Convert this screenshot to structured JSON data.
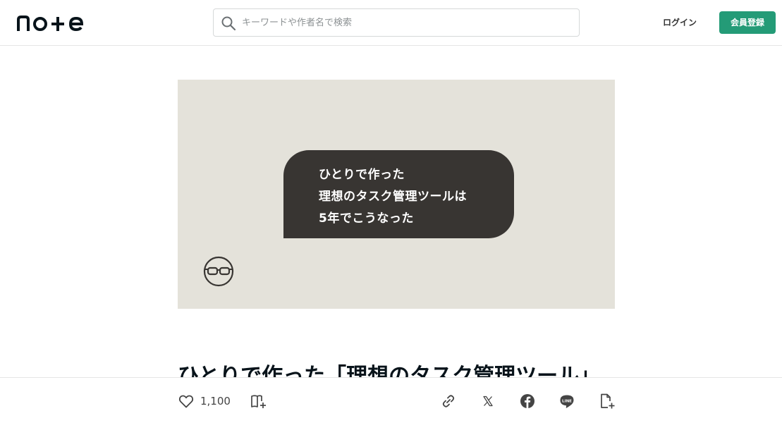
{
  "header": {
    "logo_text": "note",
    "search": {
      "placeholder": "キーワードや作者名で検索",
      "value": ""
    },
    "login_label": "ログイン",
    "signup_label": "会員登録",
    "accent_color": "#249b77"
  },
  "eyecatch": {
    "lines": [
      "ひとりで作った",
      "理想のタスク管理ツールは",
      "5年でこうなった"
    ],
    "avatar_icon": "glasses-face-icon",
    "background": "#e4e2da",
    "bubble_color": "#383532"
  },
  "article": {
    "title": "ひとりで作った「理想のタスク管理ツール」"
  },
  "actions": {
    "like_count": "1,100",
    "icons": [
      "heart-icon",
      "magazine-add-icon",
      "link-icon",
      "x-icon",
      "facebook-icon",
      "line-icon",
      "clip-add-icon"
    ]
  }
}
